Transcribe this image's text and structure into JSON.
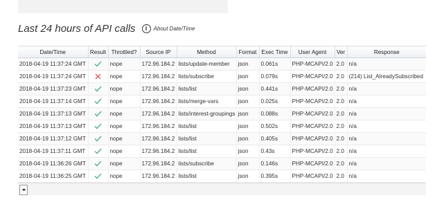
{
  "section": {
    "title": "Last 24 hours of API calls",
    "about_link": "About Date/Time"
  },
  "table": {
    "headers": [
      "Date/Time",
      "Result",
      "Throttled?",
      "Source IP",
      "Method",
      "Format",
      "Exec Time",
      "User Agent",
      "Ver",
      "Response"
    ],
    "rows": [
      {
        "datetime": "2018-04-19 11:37:24 GMT",
        "result": "success",
        "throttled": "nope",
        "ip": "172.96.184.2",
        "method": "lists/update-member",
        "format": "json",
        "exec": "0.061s",
        "agent": "PHP-MCAPI/2.0",
        "ver": "2.0",
        "response": "n/a"
      },
      {
        "datetime": "2018-04-19 11:37:24 GMT",
        "result": "failure",
        "throttled": "nope",
        "ip": "172.96.184.2",
        "method": "lists/subscribe",
        "format": "json",
        "exec": "0.079s",
        "agent": "PHP-MCAPI/2.0",
        "ver": "2.0",
        "response": "(214) List_AlreadySubscribed"
      },
      {
        "datetime": "2018-04-19 11:37:23 GMT",
        "result": "success",
        "throttled": "nope",
        "ip": "172.96.184.2",
        "method": "lists/list",
        "format": "json",
        "exec": "0.441s",
        "agent": "PHP-MCAPI/2.0",
        "ver": "2.0",
        "response": "n/a"
      },
      {
        "datetime": "2018-04-19 11:37:14 GMT",
        "result": "success",
        "throttled": "nope",
        "ip": "172.96.184.2",
        "method": "lists/merge-vars",
        "format": "json",
        "exec": "0.025s",
        "agent": "PHP-MCAPI/2.0",
        "ver": "2.0",
        "response": "n/a"
      },
      {
        "datetime": "2018-04-19 11:37:13 GMT",
        "result": "success",
        "throttled": "nope",
        "ip": "172.96.184.2",
        "method": "lists/interest-groupings",
        "format": "json",
        "exec": "0.088s",
        "agent": "PHP-MCAPI/2.0",
        "ver": "2.0",
        "response": "n/a"
      },
      {
        "datetime": "2018-04-19 11:37:13 GMT",
        "result": "success",
        "throttled": "nope",
        "ip": "172.96.184.2",
        "method": "lists/list",
        "format": "json",
        "exec": "0.502s",
        "agent": "PHP-MCAPI/2.0",
        "ver": "2.0",
        "response": "n/a"
      },
      {
        "datetime": "2018-04-19 11:37:12 GMT",
        "result": "success",
        "throttled": "nope",
        "ip": "172.96.184.2",
        "method": "lists/list",
        "format": "json",
        "exec": "0.405s",
        "agent": "PHP-MCAPI/2.0",
        "ver": "2.0",
        "response": "n/a"
      },
      {
        "datetime": "2018-04-19 11:37:11 GMT",
        "result": "success",
        "throttled": "nope",
        "ip": "172.96.184.2",
        "method": "lists/list",
        "format": "json",
        "exec": "0.43s",
        "agent": "PHP-MCAPI/2.0",
        "ver": "2.0",
        "response": "n/a"
      },
      {
        "datetime": "2018-04-19 11:36:26 GMT",
        "result": "success",
        "throttled": "nope",
        "ip": "172.96.184.2",
        "method": "lists/subscribe",
        "format": "json",
        "exec": "0.146s",
        "agent": "PHP-MCAPI/2.0",
        "ver": "2.0",
        "response": "n/a"
      },
      {
        "datetime": "2018-04-19 11:36:25 GMT",
        "result": "success",
        "throttled": "nope",
        "ip": "172.96.184.2",
        "method": "lists/list",
        "format": "json",
        "exec": "0.395s",
        "agent": "PHP-MCAPI/2.0",
        "ver": "2.0",
        "response": "n/a"
      }
    ]
  },
  "icons": {
    "success": "check-icon",
    "failure": "cross-icon",
    "info": "info-icon",
    "pager": "expand-columns-icon"
  },
  "colors": {
    "success": "#4caf84",
    "failure": "#e05a5a",
    "header_bg": "#eef0f4"
  }
}
